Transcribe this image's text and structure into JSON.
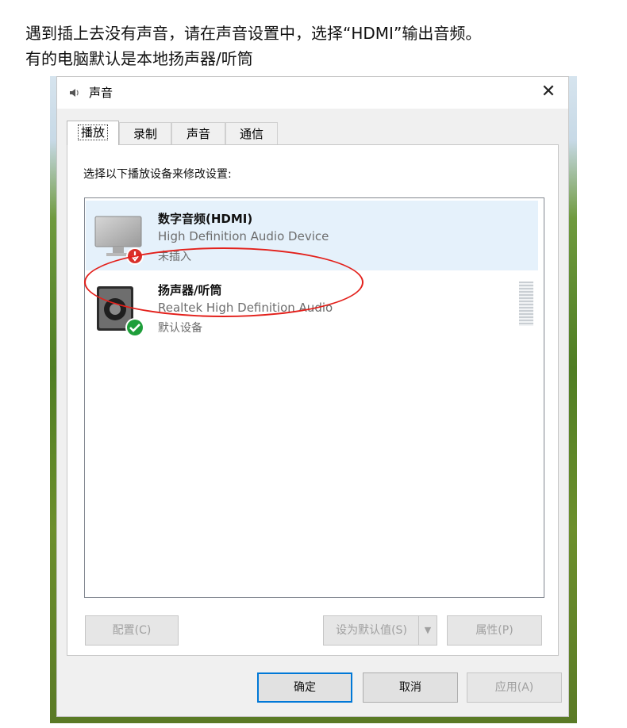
{
  "caption": {
    "line1": "遇到插上去没有声音，请在声音设置中，选择“HDMI”输出音频。",
    "line2": "有的电脑默认是本地扬声器/听筒"
  },
  "dialog": {
    "title": "声音",
    "close_label": "✕",
    "tabs": [
      {
        "label": "播放",
        "active": true
      },
      {
        "label": "录制",
        "active": false
      },
      {
        "label": "声音",
        "active": false
      },
      {
        "label": "通信",
        "active": false
      }
    ],
    "panel_label": "选择以下播放设备来修改设置:",
    "devices": [
      {
        "name": "数字音频(HDMI)",
        "description": "High Definition Audio Device",
        "status": "未插入",
        "selected": true,
        "icon": "monitor-icon",
        "badge": "unplugged-badge-icon"
      },
      {
        "name": "扬声器/听筒",
        "description": "Realtek High Definition Audio",
        "status": "默认设备",
        "selected": false,
        "icon": "speaker-icon",
        "badge": "default-check-icon"
      }
    ],
    "buttons": {
      "configure": "配置(C)",
      "set_default": "设为默认值(S)",
      "properties": "属性(P)",
      "ok": "确定",
      "cancel": "取消",
      "apply": "应用(A)"
    }
  },
  "colors": {
    "selected_row": "#e5f1fb",
    "annotation_red": "#e3201b",
    "default_button_border": "#0078d7",
    "check_green": "#1e9e3a",
    "unplugged_red": "#d9302a"
  }
}
